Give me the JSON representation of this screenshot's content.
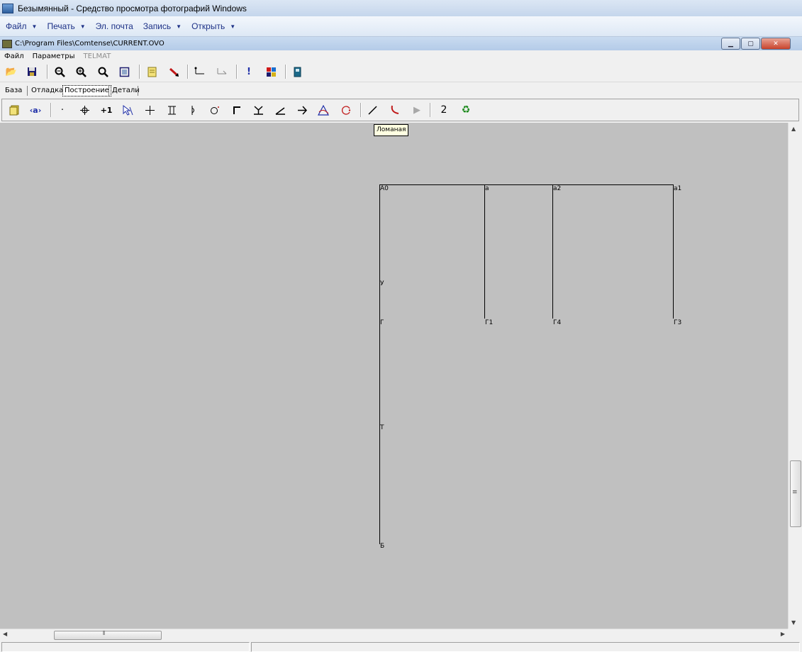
{
  "viewer": {
    "title": "Безымянный - Средство просмотра фотографий Windows",
    "menu": [
      {
        "label": "Файл"
      },
      {
        "label": "Печать"
      },
      {
        "label": "Эл. почта"
      },
      {
        "label": "Запись"
      },
      {
        "label": "Открыть"
      }
    ]
  },
  "app": {
    "title": "C:\\Program Files\\Comtense\\CURRENT.OVO",
    "menu": [
      {
        "label": "Файл"
      },
      {
        "label": "Параметры"
      },
      {
        "label": "TELMAT"
      }
    ],
    "tabs": [
      {
        "label": "База"
      },
      {
        "label": "Отладка"
      },
      {
        "label": "Построение"
      },
      {
        "label": "Детали"
      }
    ],
    "tooltip": "Ломаная",
    "toolbar2_number": "2"
  },
  "drawing": {
    "labels": [
      "А0",
      "а",
      "а2",
      "а1",
      "У",
      "Г",
      "Г1",
      "Г4",
      "Г3",
      "Т",
      "Б"
    ]
  },
  "colors": {
    "canvas": "#c0c0c0",
    "line": "#000000",
    "tooltip_bg": "#ffffe1"
  },
  "icons": [
    "open-folder-icon",
    "save-icon",
    "zoom-out-icon",
    "zoom-in-icon",
    "zoom-icon",
    "fit-window-icon",
    "notes-icon",
    "pointer-icon",
    "measure-icon",
    "measure2-icon",
    "alert-icon",
    "palette-icon",
    "book-icon",
    "object-icon",
    "eye-icon",
    "point-icon",
    "move-icon",
    "plus-one-icon",
    "select-icon",
    "cross-icon",
    "segment-icon",
    "arc-icon",
    "circle-icon",
    "corner-icon",
    "perpendicular-icon",
    "angle-icon",
    "arrow-icon",
    "triangle-icon",
    "rotate-icon",
    "line-icon",
    "polyline-icon",
    "play-icon",
    "recycle-icon"
  ]
}
